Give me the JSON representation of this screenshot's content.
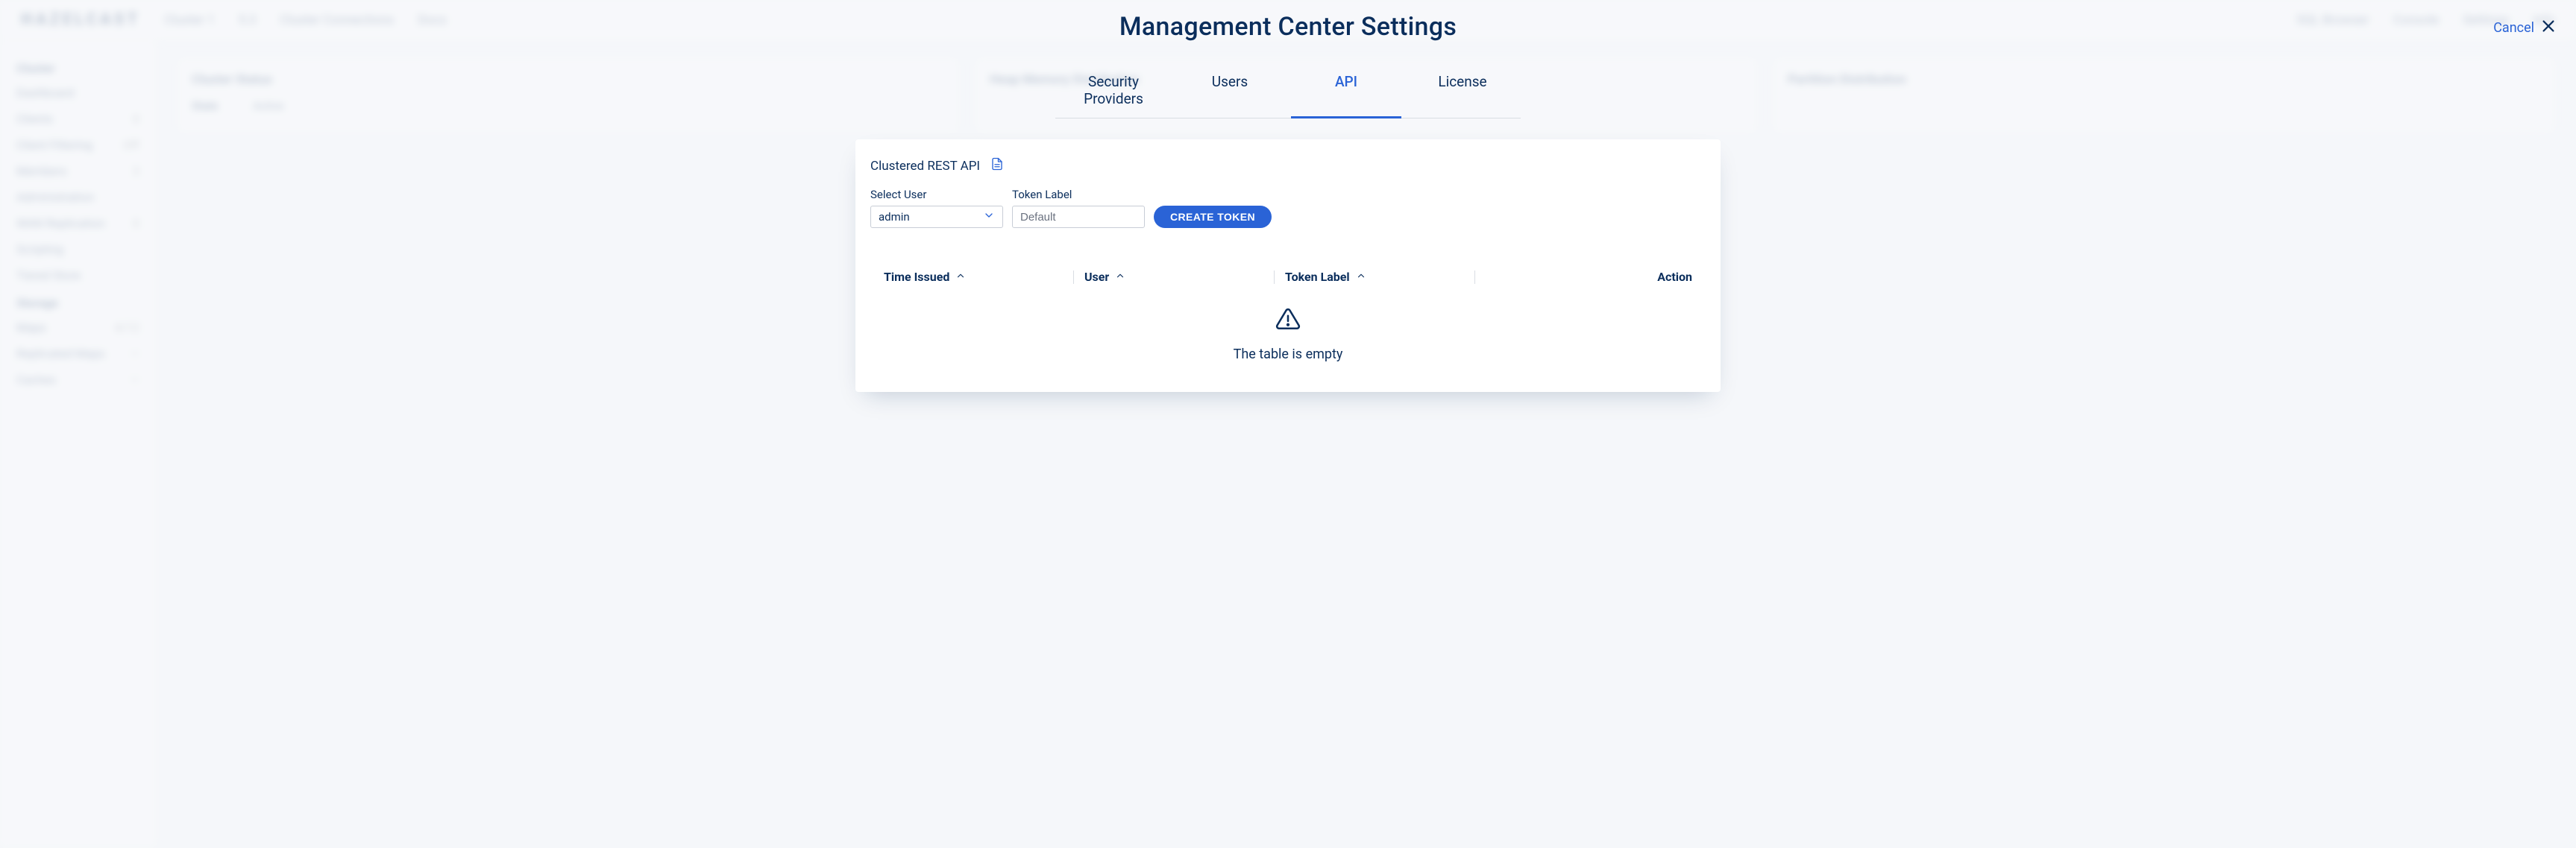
{
  "backdrop": {
    "logo": "HAZELCAST",
    "topbar": {
      "cluster_selector": "Cluster 1",
      "version_badge": "5.3",
      "center_label": "Cluster Connections",
      "docs_label": "Docs",
      "sql_browser": "SQL Browser",
      "console": "Console",
      "settings": "Settings",
      "info": "Info"
    },
    "sidebar": {
      "group_cluster": "Cluster",
      "items_cluster": [
        {
          "label": "Dashboard",
          "count": ""
        },
        {
          "label": "Clients",
          "count": "0"
        },
        {
          "label": "Client Filtering",
          "count": "Off"
        },
        {
          "label": "Members",
          "count": "3"
        },
        {
          "label": "Administration",
          "count": ""
        },
        {
          "label": "WAN Replication",
          "count": "0"
        },
        {
          "label": "Scripting",
          "count": ""
        },
        {
          "label": "Tiered Store",
          "count": ""
        }
      ],
      "group_storage": "Storage",
      "items_storage": [
        {
          "label": "Maps",
          "count": "4/12"
        },
        {
          "label": "Replicated Maps",
          "count": "—"
        },
        {
          "label": "Caches",
          "count": "—"
        }
      ]
    },
    "cards": {
      "cluster_status_title": "Cluster Status",
      "state_label": "State",
      "state_value": "Active",
      "heap_title": "Heap Memory Distribution",
      "partition_title": "Partition Distribution"
    }
  },
  "modal": {
    "title": "Management Center Settings",
    "cancel": "Cancel",
    "tabs": [
      {
        "key": "security",
        "label": "Security Providers",
        "active": false
      },
      {
        "key": "users",
        "label": "Users",
        "active": false
      },
      {
        "key": "api",
        "label": "API",
        "active": true
      },
      {
        "key": "license",
        "label": "License",
        "active": false
      }
    ],
    "api": {
      "section_title": "Clustered REST API",
      "select_user_label": "Select User",
      "select_user_value": "admin",
      "token_label_label": "Token Label",
      "token_label_placeholder": "Default",
      "create_token_button": "CREATE TOKEN",
      "columns": {
        "time_issued": "Time Issued",
        "user": "User",
        "token_label": "Token Label",
        "action": "Action"
      },
      "empty_message": "The table is empty"
    }
  }
}
